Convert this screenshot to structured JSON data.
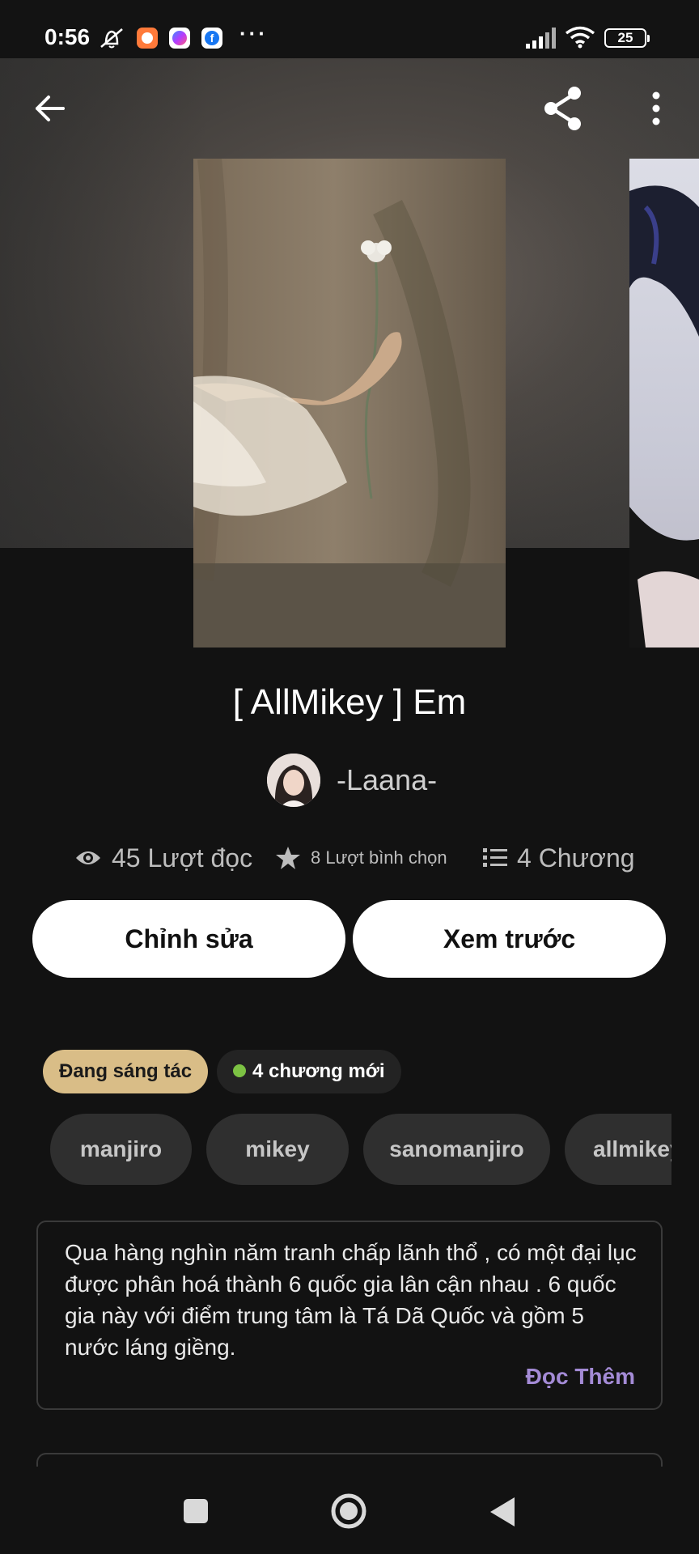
{
  "status_bar": {
    "time": "0:56",
    "battery": "25",
    "more_dots": "···"
  },
  "header": {
    "back_icon": "back-arrow-icon",
    "share_icon": "share-icon",
    "more_icon": "more-vertical-icon"
  },
  "book": {
    "title": "[ AllMikey ] Em",
    "author": "-Laana-"
  },
  "stats": {
    "reads": "45 Lượt đọc",
    "votes": "8 Lượt bình chọn",
    "chapters": "4 Chương"
  },
  "actions": {
    "edit": "Chỉnh sửa",
    "preview": "Xem trước"
  },
  "badges": {
    "status": "Đang sáng tác",
    "new_chapters": "4 chương mới"
  },
  "tags": [
    "manjiro",
    "mikey",
    "sanomanjiro",
    "allmikey"
  ],
  "description": {
    "text": "Qua hàng nghìn năm tranh chấp lãnh thổ , có một đại lục được phân hoá thành 6 quốc gia lân cận nhau . 6 quốc gia này với điểm trung tâm là Tá Dã Quốc và gồm 5 nước láng giềng.",
    "read_more": "Đọc Thêm"
  },
  "colors": {
    "background": "#121212",
    "status_badge": "#d9bd87",
    "new_dot": "#7cc243",
    "read_more": "#a48bd6",
    "tag_bg": "#2f2f2f"
  }
}
